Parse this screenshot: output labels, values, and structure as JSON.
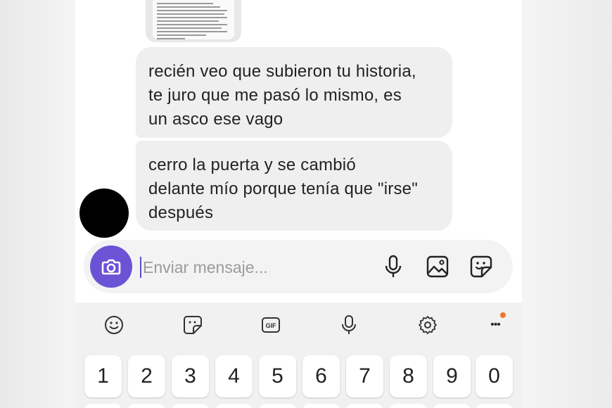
{
  "chat": {
    "messages": [
      {
        "text": "recién veo que subieron tu historia,\nte juro que me pasó lo mismo, es\nun asco ese vago"
      },
      {
        "text": "cerro la puerta y se cambió\ndelante mío porque tenía que \"irse\"\ndespués"
      }
    ]
  },
  "composer": {
    "placeholder": "Enviar mensaje...",
    "icons": [
      "camera-icon",
      "microphone-icon",
      "gallery-icon",
      "sticker-icon"
    ]
  },
  "keyboard": {
    "toolbar_icons": [
      "emoji-icon",
      "sticker-icon",
      "gif-icon",
      "microphone-icon",
      "settings-icon",
      "more-icon"
    ],
    "gif_label": "GIF",
    "more_label": "•••",
    "number_keys": [
      "1",
      "2",
      "3",
      "4",
      "5",
      "6",
      "7",
      "8",
      "9",
      "0"
    ]
  },
  "colors": {
    "accent": "#6b53d6",
    "bubble": "#efefef",
    "notification_dot": "#f0772a"
  }
}
